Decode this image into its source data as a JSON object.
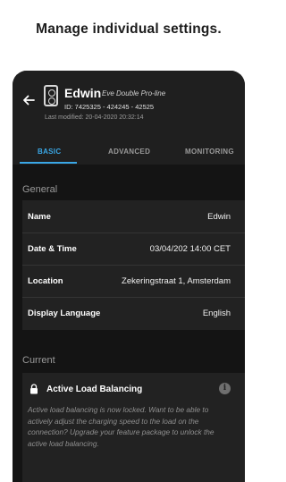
{
  "caption": "Manage individual settings.",
  "header": {
    "title": "Edwin",
    "model": "Eve Double Pro-line",
    "ids": "ID: 7425325 - 424245 - 42525",
    "last_modified": "Last modified: 20-04-2020 20:32:14"
  },
  "tabs": [
    {
      "label": "BASIC",
      "active": true
    },
    {
      "label": "ADVANCED",
      "active": false
    },
    {
      "label": "MONITORING",
      "active": false
    }
  ],
  "general": {
    "label": "General",
    "rows": [
      {
        "name": "Name",
        "value": "Edwin"
      },
      {
        "name": "Date & Time",
        "value": "03/04/202 14:00 CET"
      },
      {
        "name": "Location",
        "value": "Zekeringstraat 1, Amsterdam"
      },
      {
        "name": "Display Language",
        "value": "English"
      }
    ]
  },
  "current": {
    "label": "Current",
    "alb_title": "Active Load Balancing",
    "info_glyph": "i",
    "alb_description": "Active load balancing is now locked. Want to be able to actively adjust the charging speed to the load on the connection? Upgrade your feature package to unlock the active load balancing."
  },
  "colors": {
    "accent": "#3aa7e6",
    "phone_background": "#1f1f1f",
    "content_background": "#141414",
    "card_background": "#222222"
  },
  "icons": [
    "back-arrow-icon",
    "charger-device-icon",
    "lock-icon",
    "info-icon"
  ]
}
